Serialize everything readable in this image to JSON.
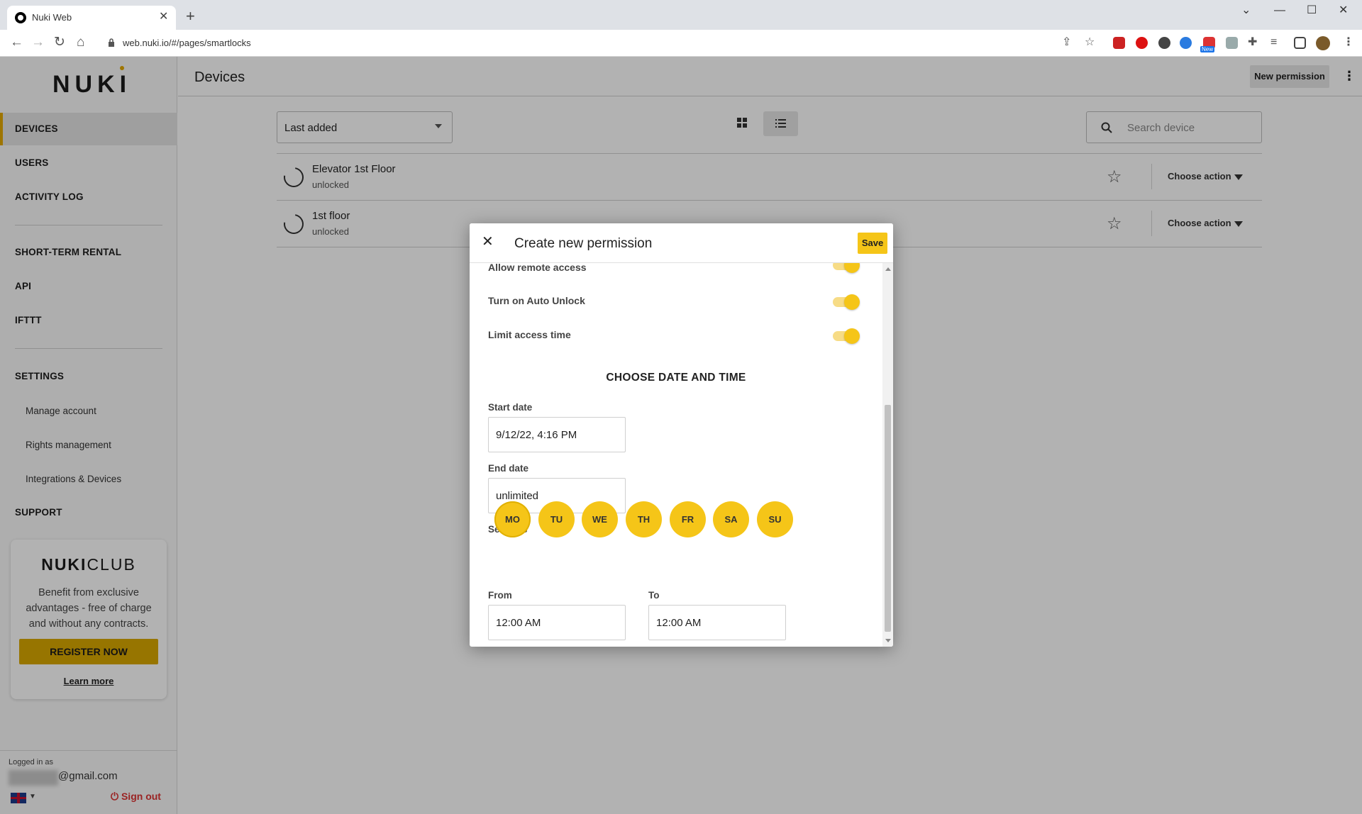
{
  "browser": {
    "tab_title": "Nuki Web",
    "url": "web.nuki.io/#/pages/smartlocks",
    "new_badge": "New"
  },
  "sidebar": {
    "logo": "NUKI",
    "nav": {
      "devices": "DEVICES",
      "users": "USERS",
      "activity_log": "ACTIVITY LOG",
      "short_term_rental": "SHORT-TERM RENTAL",
      "api": "API",
      "ifttt": "IFTTT",
      "settings": "SETTINGS",
      "manage_account": "Manage account",
      "rights_management": "Rights management",
      "integrations_devices": "Integrations & Devices",
      "support": "SUPPORT"
    },
    "club": {
      "logo_bold": "NUKI",
      "logo_light": "CLUB",
      "text": "Benefit from exclusive advantages - free of charge and without any contracts.",
      "register_label": "REGISTER NOW",
      "learn_more": "Learn more"
    },
    "footer": {
      "logged_in_label": "Logged in as",
      "email_suffix": "@gmail.com",
      "sign_out": "Sign out"
    }
  },
  "header": {
    "title": "Devices",
    "new_permission": "New permission"
  },
  "toolbar": {
    "sort_value": "Last added",
    "search_placeholder": "Search device"
  },
  "devices": [
    {
      "name": "Elevator 1st Floor",
      "status": "unlocked",
      "action": "Choose action"
    },
    {
      "name": "1st floor",
      "status": "unlocked",
      "action": "Choose action"
    }
  ],
  "modal": {
    "title": "Create new permission",
    "save_label": "Save",
    "toggles": {
      "remote_access": "Allow remote access",
      "auto_unlock": "Turn on Auto Unlock",
      "limit_access": "Limit access time"
    },
    "section_title": "CHOOSE DATE AND TIME",
    "start_date_label": "Start date",
    "start_date_value": "9/12/22, 4:16 PM",
    "end_date_label": "End date",
    "end_date_value": "unlimited",
    "set_days_label": "Set days",
    "days": [
      "MO",
      "TU",
      "WE",
      "TH",
      "FR",
      "SA",
      "SU"
    ],
    "from_label": "From",
    "from_value": "12:00 AM",
    "to_label": "To",
    "to_value": "12:00 AM"
  },
  "colors": {
    "accent": "#f5c518",
    "club_button": "#d9a800",
    "sign_out": "#dd3333"
  }
}
